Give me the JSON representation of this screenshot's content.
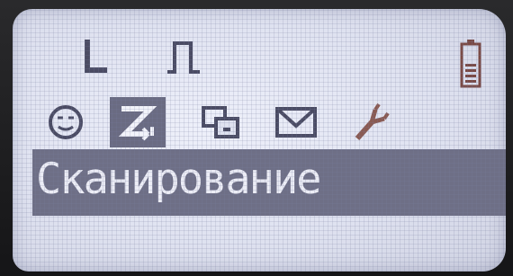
{
  "screen": {
    "status_icons": [
      "line-in-icon",
      "pulse-icon"
    ],
    "battery": {
      "icon": "battery-icon",
      "level": 0.6
    }
  },
  "menu": {
    "selected_index": 1,
    "items": [
      {
        "icon": "face-icon",
        "selected": false
      },
      {
        "icon": "scan-icon",
        "selected": true
      },
      {
        "icon": "copy-icon",
        "selected": false
      },
      {
        "icon": "mail-icon",
        "selected": false
      },
      {
        "icon": "wrench-icon",
        "selected": false
      }
    ],
    "selected_label": "Сканирование"
  },
  "colors": {
    "lcd_background": "#dfe2f0",
    "lcd_ink": "#4a4b63",
    "highlight": "#6e6f86",
    "highlight_text": "#ecedf6",
    "battery_ink": "#7a4a45"
  }
}
